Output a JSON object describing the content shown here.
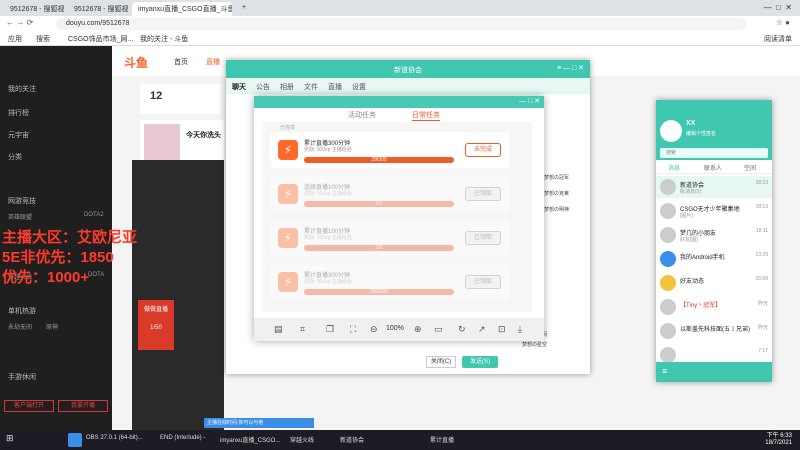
{
  "browser": {
    "tabs": [
      "9512678 - 搜狐视频 - 斗鱼直播",
      "9512678 - 搜狐视频 - 斗鱼直播",
      "imyanxu直播_CSGO直播_斗鱼",
      "游戏中心"
    ],
    "url": "douyu.com/9512678",
    "bookmarks": [
      "应用",
      "搜索",
      "CSGO饰品市场_网...",
      "我的关注 - 斗鱼"
    ],
    "reading_list": "阅读清单"
  },
  "douyu": {
    "logo": "斗鱼",
    "nav": [
      "我的关注",
      "排行榜",
      "元宇宙",
      "分类"
    ],
    "section1": "网游竞技",
    "games1": [
      "英雄联盟",
      "DOTA2",
      "穿越火线",
      "DOTA"
    ],
    "section2": "单机热游",
    "games2": [
      "永劫无间",
      "原神"
    ],
    "section3": "手游休闲",
    "head_links": [
      "首页",
      "直播"
    ],
    "streamer_count": "12",
    "promo_title": "今天你洗头",
    "bottom_left": "客户端打开",
    "bottom_right": "我要开播",
    "chest_count": "1/50",
    "chest_label": "做做直播",
    "bottom_banner": "主播在线时间,你可以与他"
  },
  "overlay_text": [
    "主播大区：艾欧尼亚",
    "5E非优先：1850",
    "优先：1000+"
  ],
  "chat": {
    "title": "新道协会",
    "tabs": [
      "聊天",
      "公告",
      "相册",
      "文件",
      "直播",
      "设置"
    ],
    "close": "关闭(C)",
    "send": "发送(S)",
    "members": [
      "梦想の冠军",
      "梦想の克莱",
      "梦想の明神",
      "梦想の时间",
      "梦想の星空"
    ]
  },
  "task_popup": {
    "tabs": [
      "活动任务",
      "日常任务"
    ],
    "header": "已完成",
    "tasks": [
      {
        "title": "累计直播300分钟",
        "sub": "奖励: 300xp  主播经验",
        "progress": "29/300",
        "button": "未完成"
      },
      {
        "title": "连续直播100分钟",
        "sub": "奖励: 100xp  主播经验",
        "progress": "1/1",
        "button": "已领取"
      },
      {
        "title": "累计直播100分钟",
        "sub": "奖励: 100xp  主播经验",
        "progress": "1/1",
        "button": "已领取"
      },
      {
        "title": "累计直播300分钟",
        "sub": "奖励: 300xp  主播经验",
        "progress": "300/300",
        "button": "已领取"
      }
    ],
    "zoom": "100%"
  },
  "qq": {
    "name": "XX",
    "status": "编辑个性签名",
    "search": "搜索",
    "tabs": [
      "消息",
      "联系人",
      "空间"
    ],
    "items": [
      {
        "name": "新道协会",
        "msg": "新消息(2)",
        "time": "18:23"
      },
      {
        "name": "CSGO无才少年聚集地",
        "msg": "[图片]",
        "time": "18:13"
      },
      {
        "name": "梦几的小朋友",
        "msg": "好友[图]",
        "time": "18:11"
      },
      {
        "name": "我的Android手机",
        "msg": "",
        "time": "13:29"
      },
      {
        "name": "好友动态",
        "msg": "",
        "time": "15:08"
      },
      {
        "name": "【Tiny丶冠军】",
        "msg": "",
        "time": "昨天"
      },
      {
        "name": "以斯盖先科技面(五丨兄弟)",
        "msg": "",
        "time": "昨天"
      },
      {
        "name": "",
        "msg": "",
        "time": "7:17"
      }
    ]
  },
  "taskbar": {
    "apps": [
      "OBS 27.0.1 (64-bit)...",
      "END (Interlude) -",
      "imyanxu直播_CSGO...",
      "穿越火线",
      "新道协会",
      "累计直播"
    ],
    "time": "下午 6:33",
    "date": "18/7/2021"
  }
}
